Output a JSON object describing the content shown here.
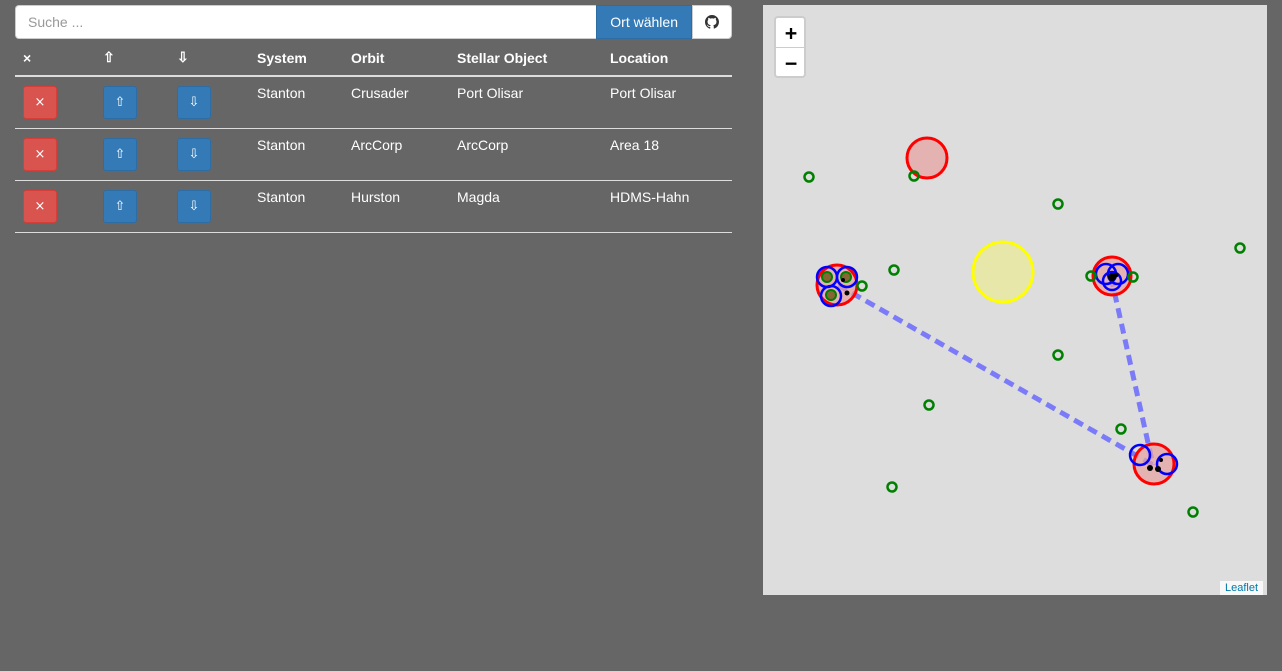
{
  "search": {
    "placeholder": "Suche ...",
    "value": ""
  },
  "choose_button": "Ort wählen",
  "github_icon": "github-icon",
  "table": {
    "headers": [
      "×",
      "⇧",
      "⇩",
      "System",
      "Orbit",
      "Stellar Object",
      "Location"
    ],
    "rows": [
      {
        "remove": "×",
        "up": "⇧",
        "down": "⇩",
        "system": "Stanton",
        "orbit": "Crusader",
        "stellar_object": "Port Olisar",
        "location": "Port Olisar"
      },
      {
        "remove": "×",
        "up": "⇧",
        "down": "⇩",
        "system": "Stanton",
        "orbit": "ArcCorp",
        "stellar_object": "ArcCorp",
        "location": "Area 18"
      },
      {
        "remove": "×",
        "up": "⇧",
        "down": "⇩",
        "system": "Stanton",
        "orbit": "Hurston",
        "stellar_object": "Magda",
        "location": "HDMS-Hahn"
      }
    ]
  },
  "map": {
    "zoom_in": "+",
    "zoom_out": "−",
    "attribution": "Leaflet",
    "colors": {
      "background": "#dddddd",
      "planet": "#ff0000",
      "moon": "#0000ff",
      "station": "#008000",
      "star": "#ffff00",
      "route": "#6b6bff"
    }
  }
}
